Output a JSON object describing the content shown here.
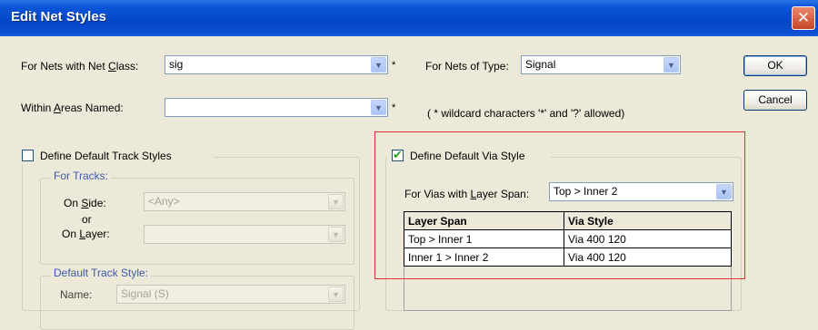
{
  "window": {
    "title": "Edit Net Styles",
    "close_glyph": "✕"
  },
  "filters": {
    "net_class_label": "For Nets with Net Class:",
    "net_class_value": "sig",
    "net_type_label": "For Nets of Type:",
    "net_type_value": "Signal",
    "areas_label": "Within Areas Named:",
    "areas_value": "",
    "asterisk": "*",
    "wildcard_note": "( * wildcard characters '*' and '?' allowed)"
  },
  "buttons": {
    "ok": "OK",
    "cancel": "Cancel"
  },
  "track_styles": {
    "checkbox_label": "Define Default Track Styles",
    "checked": false,
    "for_tracks_label": "For Tracks:",
    "on_side_label": "On Side:",
    "on_side_value": "<Any>",
    "or_label": "or",
    "on_layer_label": "On Layer:",
    "on_layer_value": "",
    "default_track_style_label": "Default Track Style:",
    "name_label": "Name:",
    "name_value": "Signal (S)"
  },
  "via_style": {
    "checkbox_label": "Define Default Via Style",
    "checked": true,
    "layer_span_label": "For Vias with Layer Span:",
    "layer_span_value": "Top > Inner 2",
    "table": {
      "headers": [
        "Layer Span",
        "Via Style"
      ],
      "rows": [
        [
          "Top > Inner 1",
          "Via 400 120"
        ],
        [
          "Inner 1 > Inner 2",
          "Via 400 120"
        ]
      ]
    }
  },
  "icons": {
    "dropdown": "chevron-down-icon",
    "checkmark": "checkmark-icon",
    "close": "close-icon"
  },
  "colors": {
    "titlebar": "#0a55d8",
    "dialog_bg": "#ece9d8",
    "highlight": "#e03030",
    "checkmark": "#21a121"
  }
}
